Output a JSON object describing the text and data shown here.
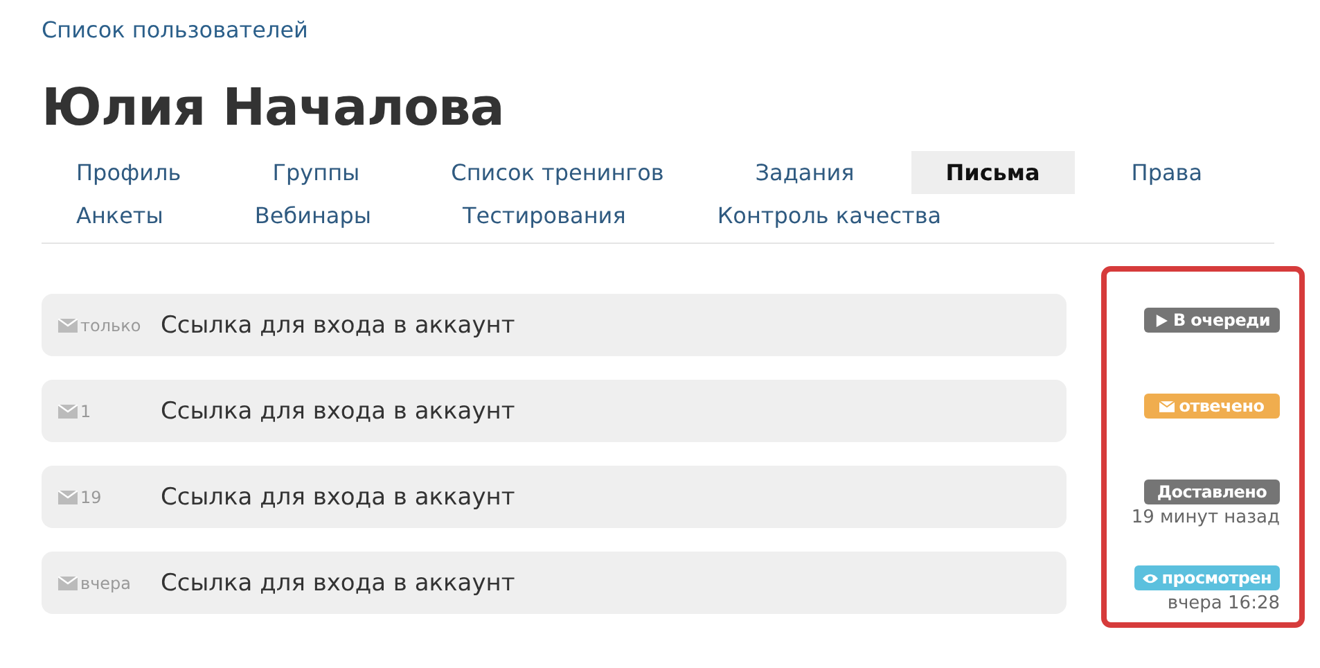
{
  "breadcrumb": "Список пользователей",
  "title": "Юлия Началова",
  "tabs": [
    {
      "label": "Профиль",
      "selected": false
    },
    {
      "label": "Группы",
      "selected": false
    },
    {
      "label": "Список тренингов",
      "selected": false
    },
    {
      "label": "Задания",
      "selected": false
    },
    {
      "label": "Письма",
      "selected": true
    },
    {
      "label": "Права",
      "selected": false
    },
    {
      "label": "Анкеты",
      "selected": false
    },
    {
      "label": "Вебинары",
      "selected": false
    },
    {
      "label": "Тестирования",
      "selected": false
    },
    {
      "label": "Контроль качества",
      "selected": false
    }
  ],
  "letters": [
    {
      "time": "только",
      "subject": "Ссылка для входа в аккаунт",
      "status": {
        "kind": "queued",
        "label": "В очереди",
        "color": "#757575"
      }
    },
    {
      "time": "1",
      "subject": "Ссылка для входа в аккаунт",
      "status": {
        "kind": "answered",
        "label": "отвечено",
        "color": "#f0ad4e"
      }
    },
    {
      "time": "19",
      "subject": "Ссылка для входа в аккаунт",
      "status": {
        "kind": "plain",
        "label": "Доставлено",
        "color": "#757575",
        "note": "19 минут назад"
      }
    },
    {
      "time": "вчера",
      "subject": "Ссылка для входа в аккаунт",
      "status": {
        "kind": "viewed",
        "label": "просмотрен",
        "color": "#5bc0de",
        "note": "вчера 16:28"
      }
    }
  ]
}
